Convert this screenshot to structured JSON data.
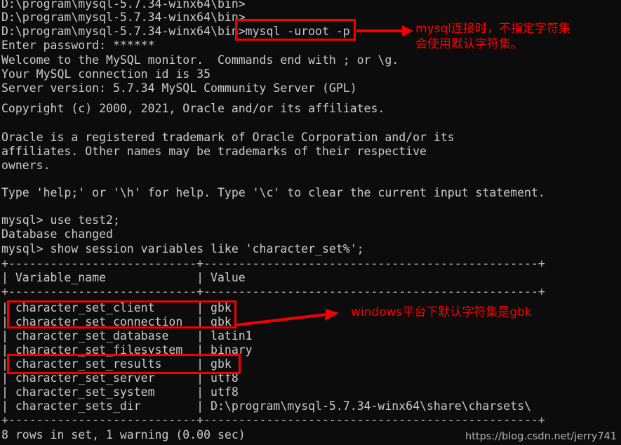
{
  "terminal": {
    "background_color": "#0c0c0c",
    "text_color": "#cccccc",
    "lines": [
      "D:\\program\\mysql-5.7.34-winx64\\bin>",
      "D:\\program\\mysql-5.7.34-winx64\\bin>",
      "D:\\program\\mysql-5.7.34-winx64\\bin>mysql -uroot -p",
      "Enter password: ******",
      "Welcome to the MySQL monitor.  Commands end with ; or \\g.",
      "Your MySQL connection id is 35",
      "Server version: 5.7.34 MySQL Community Server (GPL)",
      "",
      "Copyright (c) 2000, 2021, Oracle and/or its affiliates.",
      "",
      "Oracle is a registered trademark of Oracle Corporation and/or its",
      "affiliates. Other names may be trademarks of their respective",
      "owners.",
      "",
      "Type 'help;' or '\\h' for help. Type '\\c' to clear the current input statement.",
      "",
      "mysql> use test2;",
      "Database changed",
      "mysql> show session variables like 'character_set%';"
    ],
    "prompt_command": "mysql -uroot -p",
    "password_prompt": "Enter password: ******",
    "footer": "8 rows in set, 1 warning (0.00 sec)"
  },
  "result_table": {
    "top_rule": "+---------------------------+------------------------------------------------+",
    "header_rule": "+---------------------------+------------------------------------------------+",
    "bottom_rule": "+---------------------------+------------------------------------------------+",
    "columns": [
      "Variable_name",
      "Value"
    ],
    "rows": [
      {
        "name": "character_set_client",
        "value": "gbk"
      },
      {
        "name": "character_set_connection",
        "value": "gbk"
      },
      {
        "name": "character_set_database",
        "value": "latin1"
      },
      {
        "name": "character_set_filesystem",
        "value": "binary"
      },
      {
        "name": "character_set_results",
        "value": "gbk"
      },
      {
        "name": "character_set_server",
        "value": "utf8"
      },
      {
        "name": "character_set_system",
        "value": "utf8"
      },
      {
        "name": "character_sets_dir",
        "value": "D:\\program\\mysql-5.7.34-winx64\\share\\charsets\\"
      }
    ]
  },
  "annotations": {
    "color": "#fc0000",
    "note_connect_line1": "mysql连接时，不指定字符集",
    "note_connect_line2": "会使用默认字符集。",
    "note_charset": "windows平台下默认字符集是gbk"
  },
  "watermark": {
    "text": "https://blog.csdn.net/jerry741"
  }
}
